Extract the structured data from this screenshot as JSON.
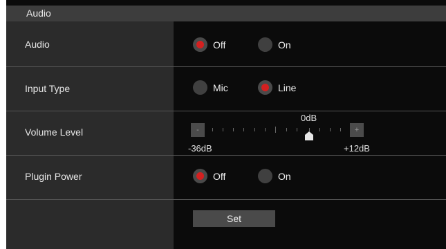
{
  "section": {
    "title": "Audio"
  },
  "rows": {
    "audio": {
      "label": "Audio",
      "options": [
        "Off",
        "On"
      ],
      "selected": "Off"
    },
    "input_type": {
      "label": "Input Type",
      "options": [
        "Mic",
        "Line"
      ],
      "selected": "Line"
    },
    "volume_level": {
      "label": "Volume Level",
      "decrement": "-",
      "increment": "+",
      "min_label": "-36dB",
      "max_label": "+12dB",
      "current_label": "0dB",
      "min": -36,
      "max": 12,
      "value": 0
    },
    "plugin_power": {
      "label": "Plugin Power",
      "options": [
        "Off",
        "On"
      ],
      "selected": "Off"
    }
  },
  "actions": {
    "set_label": "Set"
  },
  "colors": {
    "selected_dot": "#d42020",
    "label_bg": "#2b2b2b",
    "header_bg": "#3d3d3d"
  }
}
